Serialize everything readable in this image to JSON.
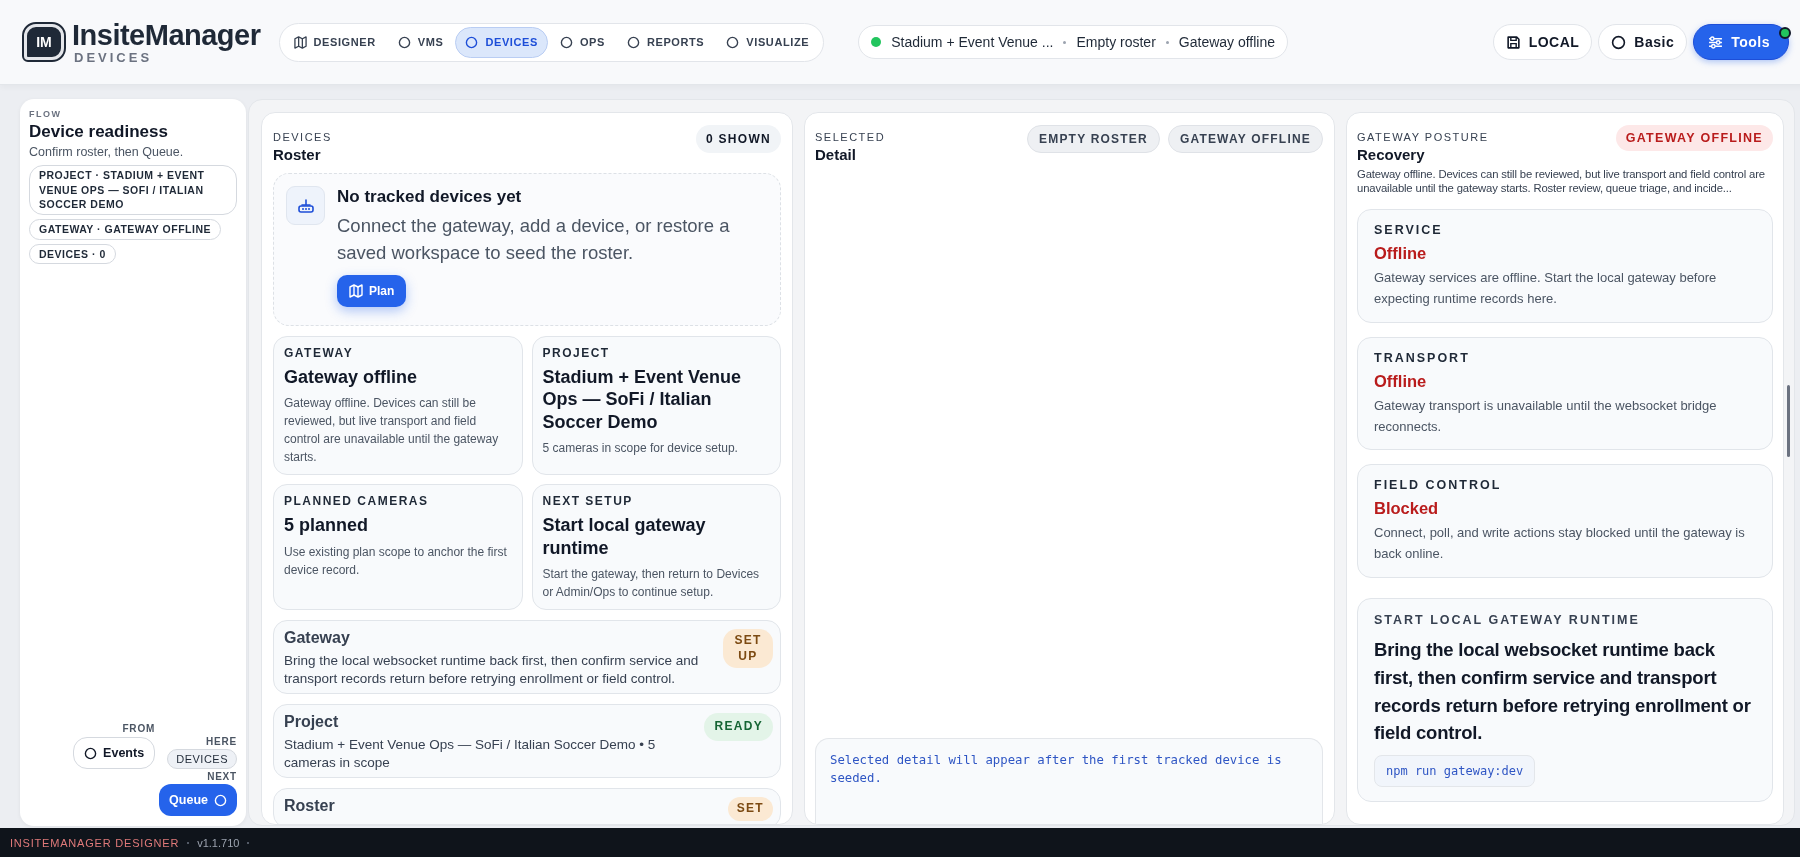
{
  "brand": {
    "mark": "IM",
    "name": "InsiteManager",
    "subtitle": "DEVICES"
  },
  "nav": [
    {
      "label": "DESIGNER",
      "kind": "map",
      "selected": false
    },
    {
      "label": "VMS",
      "kind": "circle",
      "selected": false
    },
    {
      "label": "DEVICES",
      "kind": "circle",
      "selected": true
    },
    {
      "label": "OPS",
      "kind": "circle",
      "selected": false
    },
    {
      "label": "REPORTS",
      "kind": "circle",
      "selected": false
    },
    {
      "label": "VISUALIZE",
      "kind": "circle",
      "selected": false
    }
  ],
  "status": {
    "items": [
      "Stadium + Event Venue ...",
      "Empty roster",
      "Gateway offline"
    ]
  },
  "actions": [
    {
      "label": "LOCAL",
      "kind": "save",
      "primary": false,
      "indicator": false
    },
    {
      "label": "Basic",
      "kind": "circle",
      "primary": false,
      "indicator": false
    },
    {
      "label": "Tools",
      "kind": "sliders",
      "primary": true,
      "indicator": true
    }
  ],
  "flow": {
    "eyebrow": "FLOW",
    "title": "Device readiness",
    "hint": "Confirm roster, then Queue.",
    "chips": [
      "PROJECT · STADIUM + EVENT VENUE OPS — SOFI / ITALIAN SOCCER DEMO",
      "GATEWAY · GATEWAY OFFLINE",
      "DEVICES · 0"
    ],
    "from_label": "FROM",
    "from": "Events",
    "here_label": "HERE",
    "here": "DEVICES",
    "next_label": "NEXT",
    "next": "Queue"
  },
  "roster": {
    "eyebrow": "DEVICES",
    "title": "Roster",
    "count": "0 SHOWN",
    "empty": {
      "title": "No tracked devices yet",
      "text": "Connect the gateway, add a device, or restore a saved workspace to seed the roster.",
      "button": "Plan"
    },
    "cards": [
      {
        "eyebrow": "GATEWAY",
        "title": "Gateway offline",
        "text": "Gateway offline. Devices can still be reviewed, but live transport and field control are unavailable until the gateway starts."
      },
      {
        "eyebrow": "PROJECT",
        "title": "Stadium + Event Venue Ops — SoFi / Italian Soccer Demo",
        "text": "5 cameras in scope for device setup."
      },
      {
        "eyebrow": "PLANNED CAMERAS",
        "title": "5 planned",
        "text": "Use existing plan scope to anchor the first device record."
      },
      {
        "eyebrow": "NEXT SETUP",
        "title": "Start local gateway runtime",
        "text": "Start the gateway, then return to Devices or Admin/Ops to continue setup."
      }
    ],
    "rows": [
      {
        "title": "Gateway",
        "text": "Bring the local websocket runtime back first, then confirm service and transport records return before retrying enrollment or field control.",
        "status": "SET UP",
        "kind": "setup"
      },
      {
        "title": "Project",
        "text": "Stadium + Event Venue Ops — SoFi / Italian Soccer Demo • 5 cameras in scope",
        "status": "READY",
        "kind": "ready"
      },
      {
        "title": "Roster",
        "status": "SET",
        "kind": "setup"
      }
    ]
  },
  "detail": {
    "eyebrow": "SELECTED",
    "title": "Detail",
    "tags": [
      "EMPTY ROSTER",
      "GATEWAY OFFLINE"
    ],
    "note": "Selected detail will appear after the first tracked device is seeded."
  },
  "posture": {
    "eyebrow": "GATEWAY POSTURE",
    "title": "Recovery",
    "badge": "GATEWAY OFFLINE",
    "text": "Gateway offline. Devices can still be reviewed, but live transport and field control are unavailable until the gateway starts. Roster review, queue triage, and incide...",
    "checks": [
      {
        "label": "SERVICE",
        "value": "Offline",
        "text": "Gateway services are offline. Start the local gateway before expecting runtime records here."
      },
      {
        "label": "TRANSPORT",
        "value": "Offline",
        "text": "Gateway transport is unavailable until the websocket bridge reconnects."
      },
      {
        "label": "FIELD CONTROL",
        "value": "Blocked",
        "text": "Connect, poll, and write actions stay blocked until the gateway is back online."
      }
    ],
    "next": {
      "eyebrow": "START LOCAL GATEWAY RUNTIME",
      "text": "Bring the local websocket runtime back first, then confirm service and transport records return before retrying enrollment or field control.",
      "command": "npm run gateway:dev"
    }
  },
  "footer": {
    "app": "INSITEMANAGER DESIGNER",
    "version": "v1.1.710"
  }
}
